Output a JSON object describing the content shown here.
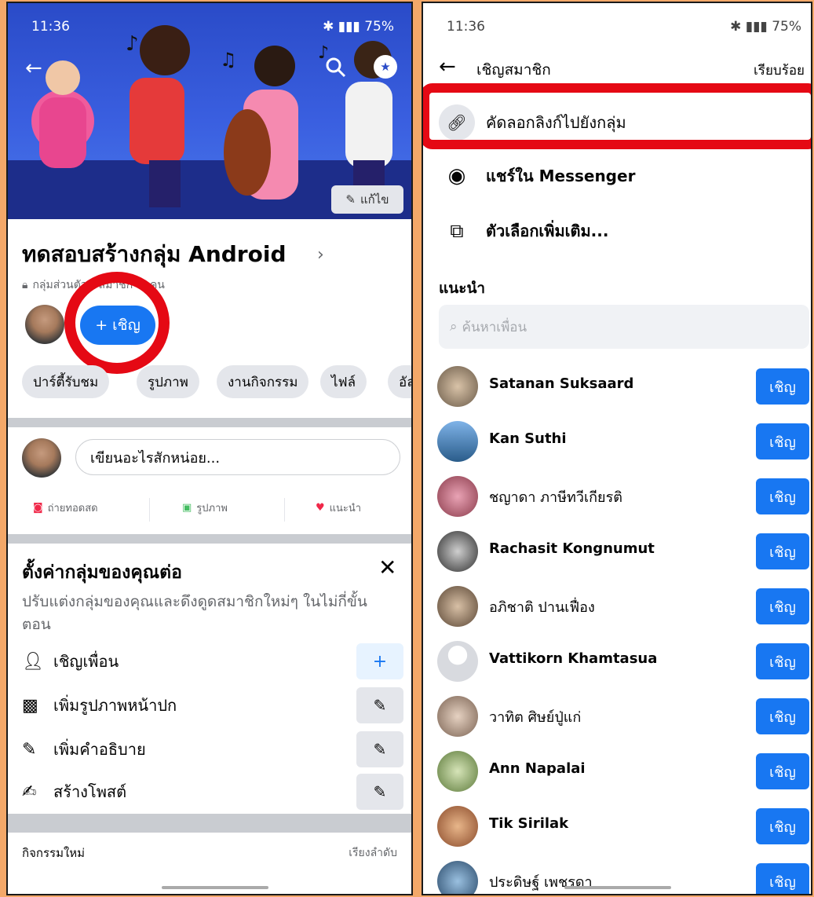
{
  "left": {
    "status": {
      "time": "11:36",
      "battery": "75%"
    },
    "cover": {
      "edit_label": "แก้ไข"
    },
    "group": {
      "name": "ทดสอบสร้างกลุ่ม Android",
      "privacy": "กลุ่มส่วนตัว",
      "members_prefix": "· สมาชิก",
      "members_count": "1",
      "members_suffix": "คน"
    },
    "invite_label": "+ เชิญ",
    "chips": [
      "ปาร์ตี้รับชม",
      "รูปภาพ",
      "งานกิจกรรม",
      "ไฟล์",
      "อัล"
    ],
    "composer": {
      "placeholder": "เขียนอะไรสักหน่อย..."
    },
    "actions": [
      "ถ่ายทอดสด",
      "รูปภาพ",
      "แนะนำ"
    ],
    "setup": {
      "title": "ตั้งค่ากลุ่มของคุณต่อ",
      "description": "ปรับแต่งกลุ่มของคุณและดึงดูดสมาชิกใหม่ๆ ในไม่กี่ขั้นตอน",
      "items": [
        "เชิญเพื่อน",
        "เพิ่มรูปภาพหน้าปก",
        "เพิ่มคำอธิบาย",
        "สร้างโพสต์"
      ]
    },
    "activity": {
      "title": "กิจกรรมใหม่",
      "sort": "เรียงลำดับ"
    }
  },
  "right": {
    "status": {
      "time": "11:36",
      "battery": "75%"
    },
    "header": {
      "title": "เชิญสมาชิก",
      "done": "เรียบร้อย"
    },
    "options": [
      "คัดลอกลิงก์ไปยังกลุ่ม",
      "แชร์ใน Messenger",
      "ตัวเลือกเพิ่มเติม..."
    ],
    "suggest_label": "แนะนำ",
    "search_placeholder": "ค้นหาเพื่อน",
    "invite_label": "เชิญ",
    "friends": [
      "Satanan Suksaard",
      "Kan Suthi",
      "ชญาดา ภาษีทวีเกียรติ",
      "Rachasit Kongnumut",
      "อภิชาติ ปานเฟื่อง",
      "Vattikorn Khamtasua",
      "วาทิต ศิษย์ปู่แก่",
      "Ann Napalai",
      "Tik Sirilak",
      "ประดิษฐ์ เพชรดา"
    ]
  },
  "colors": {
    "accent": "#1877f2",
    "highlight": "#e50914",
    "background": "#f3a869"
  }
}
